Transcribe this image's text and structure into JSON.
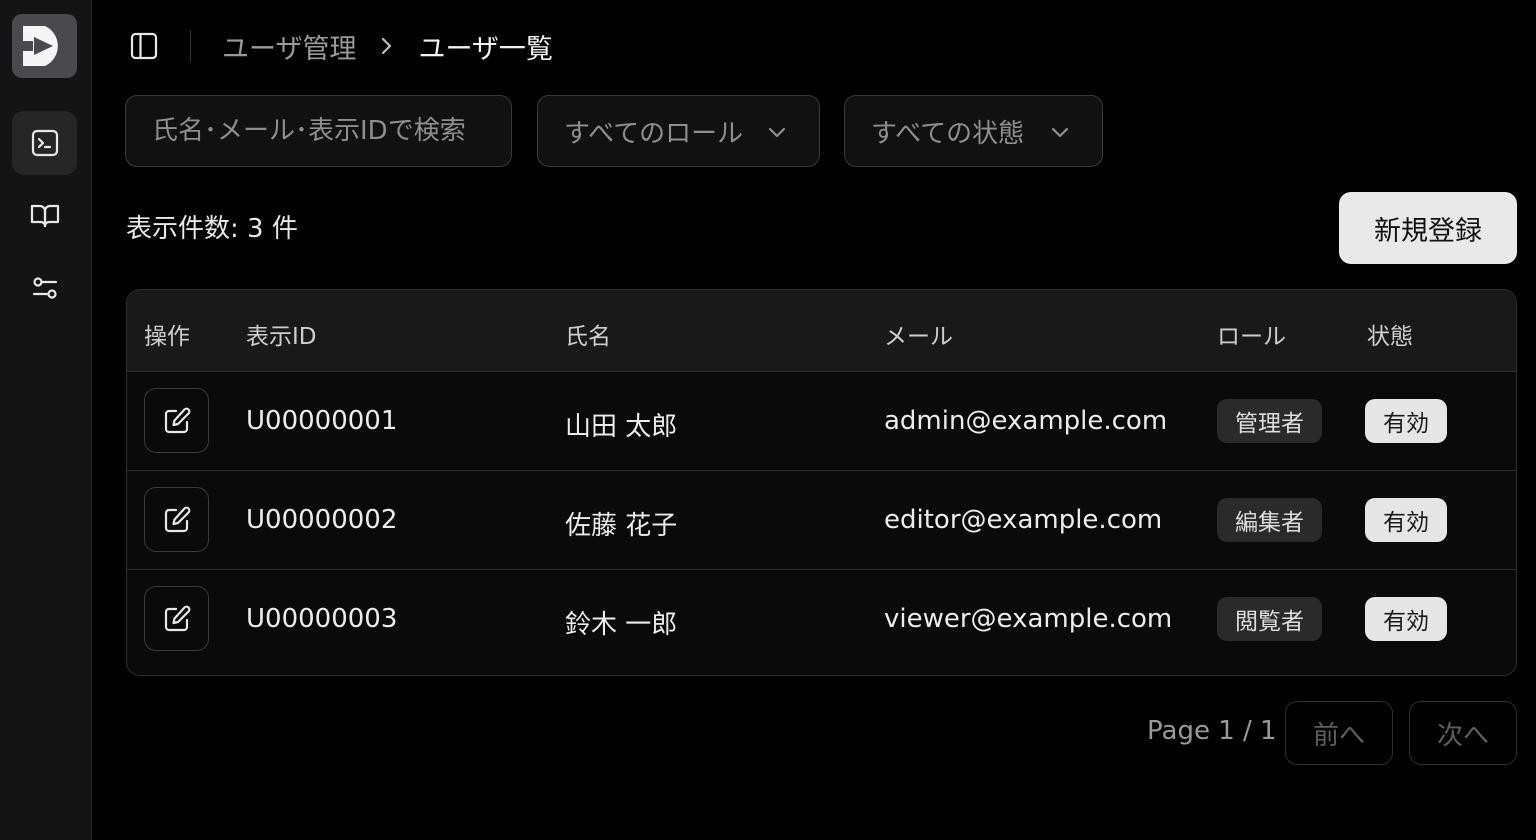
{
  "header": {
    "breadcrumb_parent": "ユーザ管理",
    "breadcrumb_current": "ユーザ一覧"
  },
  "filters": {
    "search_placeholder": "氏名･メール･表示IDで検索",
    "role_selected": "すべてのロール",
    "status_selected": "すべての状態"
  },
  "result_count": "表示件数: 3 件",
  "new_button_label": "新規登録",
  "table": {
    "columns": [
      "操作",
      "表示ID",
      "氏名",
      "メール",
      "ロール",
      "状態"
    ],
    "rows": [
      {
        "id": "U00000001",
        "name": "山田 太郎",
        "email": "admin@example.com",
        "role": "管理者",
        "status": "有効"
      },
      {
        "id": "U00000002",
        "name": "佐藤 花子",
        "email": "editor@example.com",
        "role": "編集者",
        "status": "有効"
      },
      {
        "id": "U00000003",
        "name": "鈴木 一郎",
        "email": "viewer@example.com",
        "role": "閲覧者",
        "status": "有効"
      }
    ]
  },
  "pagination": {
    "info": "Page 1 / 1",
    "prev_label": "前へ",
    "next_label": "次へ"
  },
  "icons": {
    "logo": "d-logo-icon",
    "nav": [
      "terminal-icon",
      "book-open-icon",
      "settings-sliders-icon"
    ],
    "sidebar_toggle": "sidebar-toggle-icon",
    "edit": "edit-pencil-icon",
    "chevron": "chevron-down-icon"
  },
  "colors": {
    "background": "#000000",
    "sidebar": "#141414",
    "primary_button": "#e9e9e9",
    "status_badge": "#e6e6e6",
    "role_badge": "#2a2a2a"
  }
}
